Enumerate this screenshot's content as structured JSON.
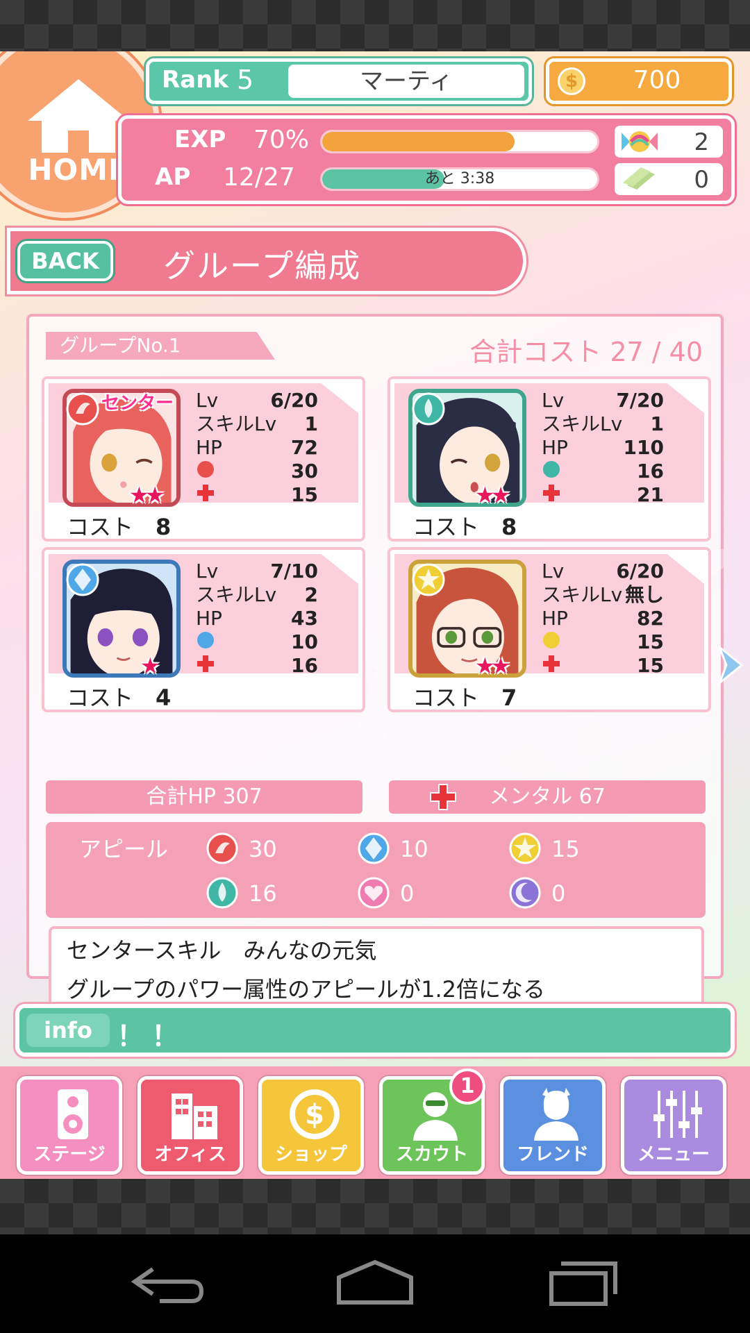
{
  "header": {
    "home_label": "HOME",
    "rank_label": "Rank",
    "rank_value": "5",
    "player_name": "マーティ",
    "coins": "700",
    "exp_label": "EXP",
    "exp_value": "70%",
    "exp_progress": 0.7,
    "ap_label": "AP",
    "ap_value": "12/27",
    "ap_progress": 0.444,
    "ap_remaining": "あと 3:38",
    "candy_count": "2",
    "ticket_count": "0"
  },
  "title_bar": {
    "back_label": "BACK",
    "title": "グループ編成"
  },
  "group": {
    "tab_label": "グループNo.1",
    "total_cost": "合計コスト 27 / 40",
    "center_badge": "センター",
    "labels": {
      "lv": "Lv",
      "skill_lv": "スキルLv",
      "hp": "HP",
      "cost": "コスト"
    },
    "cards": [
      {
        "lv": "6/20",
        "skill_lv": "1",
        "hp": "72",
        "appeal": "30",
        "mental": "15",
        "cost": "8",
        "attribute": "power-fire",
        "rarity": "★★"
      },
      {
        "lv": "7/20",
        "skill_lv": "1",
        "hp": "110",
        "appeal": "16",
        "mental": "21",
        "cost": "8",
        "attribute": "aqua-drop",
        "rarity": "★★"
      },
      {
        "lv": "7/10",
        "skill_lv": "2",
        "hp": "43",
        "appeal": "10",
        "mental": "16",
        "cost": "4",
        "attribute": "blue-diamond",
        "rarity": "★"
      },
      {
        "lv": "6/20",
        "skill_lv": "無し",
        "hp": "82",
        "appeal": "15",
        "mental": "15",
        "cost": "7",
        "attribute": "yellow-star",
        "rarity": "★★"
      }
    ],
    "total_hp": "合計HP 307",
    "mental": "メンタル 67",
    "appeal_label": "アピール",
    "appeal_values": {
      "power": "30",
      "diamond": "10",
      "star": "15",
      "drop": "16",
      "heart": "0",
      "moon": "0"
    },
    "center_skill_name": "センタースキル　みんなの元気",
    "center_skill_desc": "グループのパワー属性のアピールが1.2倍になる"
  },
  "info": {
    "tag": "info",
    "text": "！！"
  },
  "menu": {
    "items": [
      {
        "label": "ステージ",
        "color": "#f58fc0",
        "icon": "speaker-icon"
      },
      {
        "label": "オフィス",
        "color": "#ee5a6e",
        "icon": "building-icon"
      },
      {
        "label": "ショップ",
        "color": "#f5c53a",
        "icon": "coin-icon"
      },
      {
        "label": "スカウト",
        "color": "#6cc45a",
        "icon": "scout-person-icon",
        "badge": "1"
      },
      {
        "label": "フレンド",
        "color": "#5b8fe0",
        "icon": "friend-person-icon"
      },
      {
        "label": "メニュー",
        "color": "#a98be0",
        "icon": "sliders-icon"
      }
    ]
  },
  "colors": {
    "accent_pink": "#f07a8f",
    "teal": "#5cc3a3",
    "orange": "#f5a93f"
  }
}
